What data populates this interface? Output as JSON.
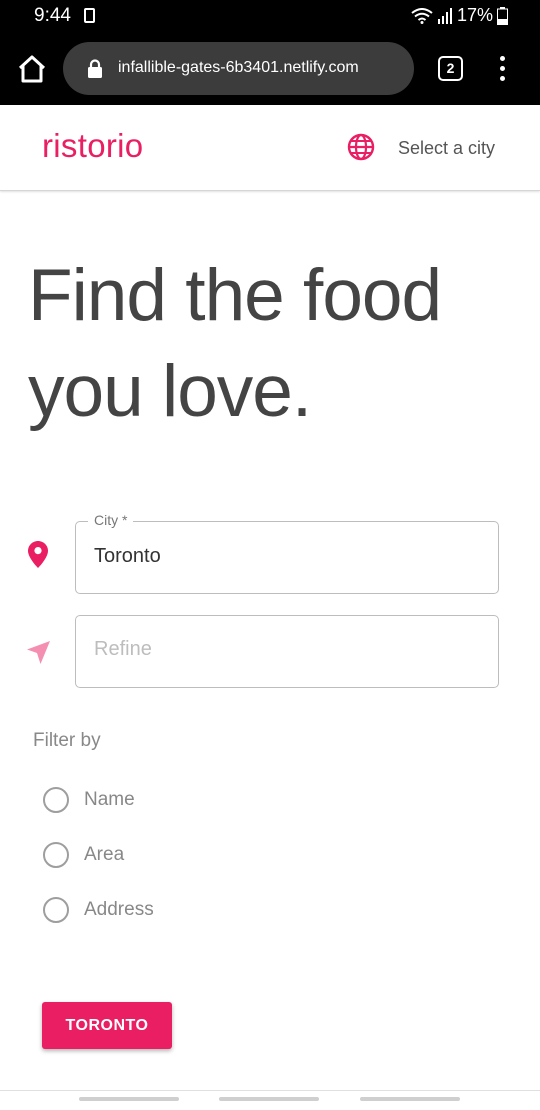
{
  "status_bar": {
    "time": "9:44",
    "battery": "17%",
    "icons": [
      "sim-icon",
      "wifi-icon",
      "signal-icon",
      "battery-icon"
    ]
  },
  "browser": {
    "url": "infallible-gates-6b3401.netlify.com",
    "tab_count": "2",
    "icons": [
      "home-icon",
      "lock-icon",
      "menu-dots-icon"
    ]
  },
  "header": {
    "logo": "ristorio",
    "city_select_label": "Select a city",
    "icon": "globe-icon"
  },
  "hero": {
    "line1": "Find the food",
    "line2": "you love."
  },
  "form": {
    "city": {
      "label": "City *",
      "value": "Toronto",
      "icon": "map-pin-icon"
    },
    "refine": {
      "placeholder": "Refine",
      "icon": "navigation-arrow-icon"
    },
    "filter_title": "Filter by",
    "filters": [
      {
        "label": "Name",
        "selected": false
      },
      {
        "label": "Area",
        "selected": false
      },
      {
        "label": "Address",
        "selected": false
      }
    ],
    "submit_label": "TORONTO"
  },
  "colors": {
    "accent": "#e91e63",
    "accent_light": "#f48fb1",
    "text_primary": "#444444",
    "text_muted": "#888888"
  }
}
